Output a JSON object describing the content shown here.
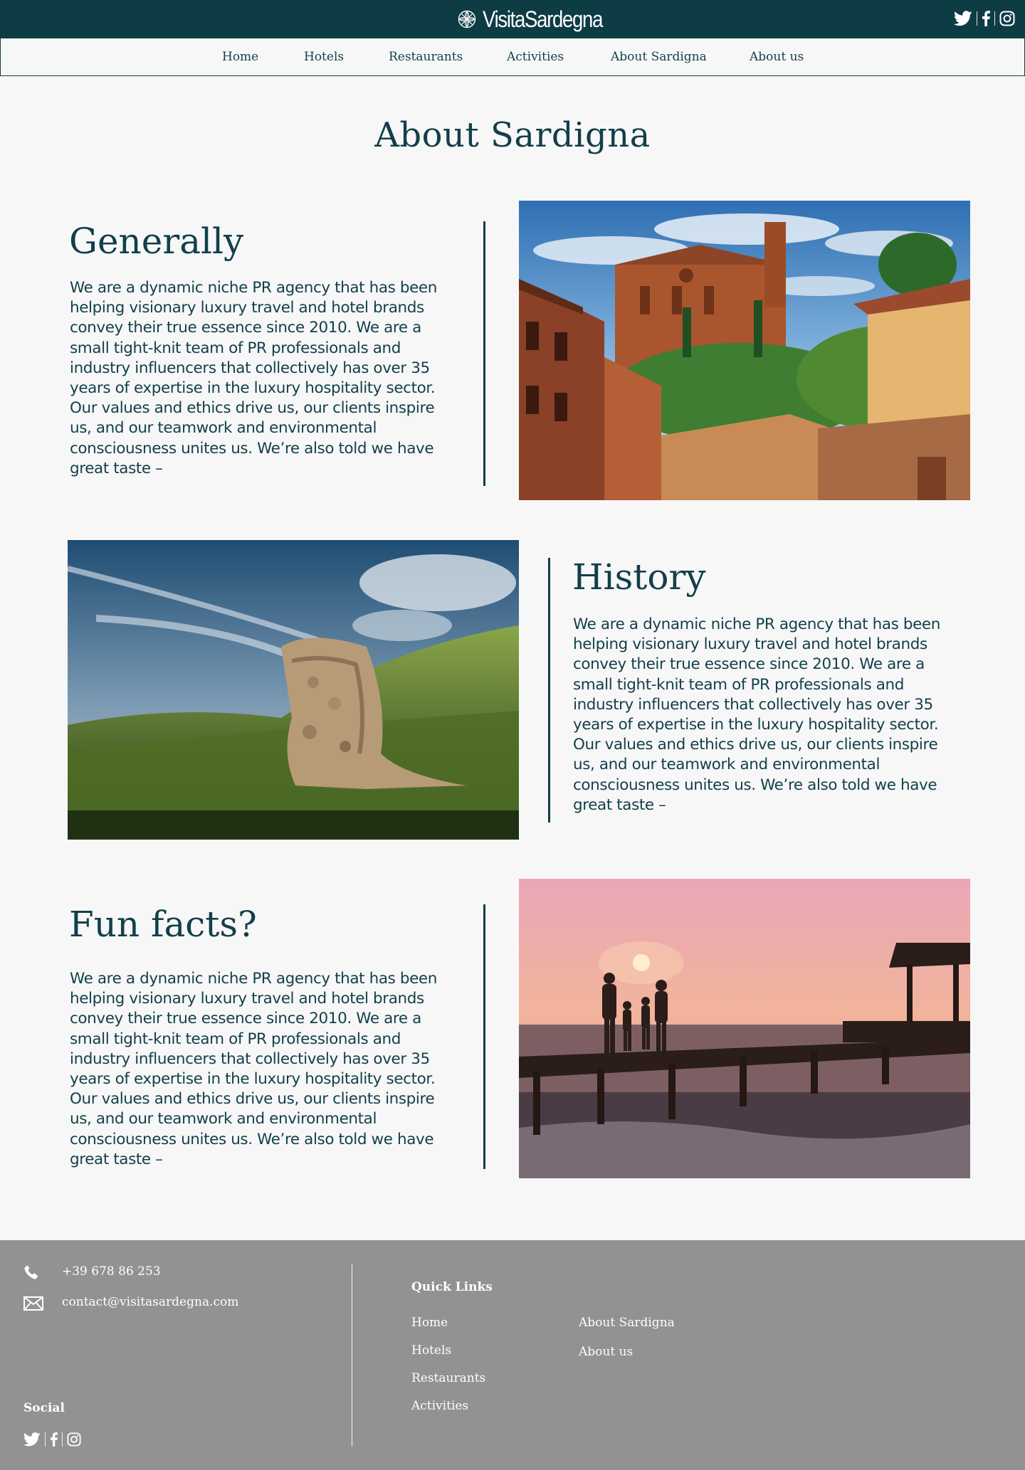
{
  "header": {
    "brand": "VisitaSardegna",
    "social_icons": [
      "twitter-icon",
      "facebook-icon",
      "instagram-icon"
    ]
  },
  "nav": {
    "items": [
      {
        "label": "Home"
      },
      {
        "label": "Hotels"
      },
      {
        "label": "Restaurants"
      },
      {
        "label": "Activities"
      },
      {
        "label": "About Sardigna"
      },
      {
        "label": "About us"
      }
    ]
  },
  "page": {
    "title": "About Sardigna"
  },
  "sections": [
    {
      "heading": "Generally",
      "body": "We are a dynamic niche PR agency that has been helping visionary luxury travel and hotel brands convey their true essence since 2010. We are a small tight-knit team of PR professionals and industry influencers that collectively has over 35 years of expertise in the luxury hospitality sector. Our values and ethics drive us, our clients inspire us, and our teamwork and environmental consciousness unites us. We’re also told we have great taste –"
    },
    {
      "heading": "History",
      "body": "We are a dynamic niche PR agency that has been helping visionary luxury travel and hotel brands convey their true essence since 2010. We are a small tight-knit team of PR professionals and industry influencers that collectively has over 35 years of expertise in the luxury hospitality sector. Our values and ethics drive us, our clients inspire us, and our teamwork and environmental consciousness unites us. We’re also told we have great taste –"
    },
    {
      "heading": "Fun facts?",
      "body": "We are a dynamic niche PR agency that has been helping visionary luxury travel and hotel brands convey their true essence since 2010. We are a small tight-knit team of PR professionals and industry influencers that collectively has over 35 years of expertise in the luxury hospitality sector. Our values and ethics drive us, our clients inspire us, and our teamwork and environmental consciousness unites us. We’re also told we have great taste –"
    }
  ],
  "footer": {
    "phone": "+39 678 86 253",
    "email": "contact@visitasardegna.com",
    "quick_links_heading": "Quick Links",
    "quick_links": [
      {
        "label": "Home"
      },
      {
        "label": "Hotels"
      },
      {
        "label": "Restaurants"
      },
      {
        "label": "Activities"
      },
      {
        "label": "About Sardigna"
      },
      {
        "label": "About us"
      }
    ],
    "social_heading": "Social",
    "social_icons": [
      "twitter-icon",
      "facebook-icon",
      "instagram-icon"
    ]
  },
  "colors": {
    "header_bg": "#0e3c45",
    "text_primary": "#123f4a",
    "page_bg": "#f7f7f7",
    "footer_bg": "#929292"
  }
}
